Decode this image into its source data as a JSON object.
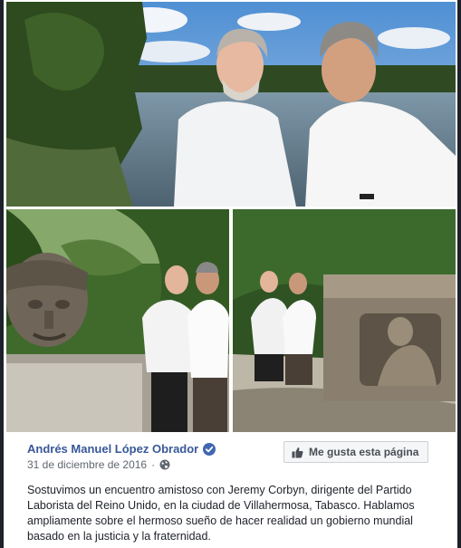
{
  "post": {
    "author": "Andrés Manuel López Obrador",
    "date": "31 de diciembre de 2016",
    "date_separator": "·",
    "like_page_label": "Me gusta esta página",
    "text": "Sostuvimos un encuentro amistoso con Jeremy Corbyn, dirigente del Partido Laborista del Reino Unido, en la ciudad de Villahermosa, Tabasco. Hablamos ampliamente sobre el hermoso sueño de hacer realidad un gobierno mundial basado en la justicia y la fraternidad."
  },
  "icons": {
    "verified": "verified-badge-icon",
    "audience": "globe-icon",
    "like": "thumbs-up-icon"
  },
  "colors": {
    "author_link": "#385898",
    "verified_badge": "#4267b2",
    "meta_text": "#616770",
    "button_bg": "#f5f6f7"
  }
}
